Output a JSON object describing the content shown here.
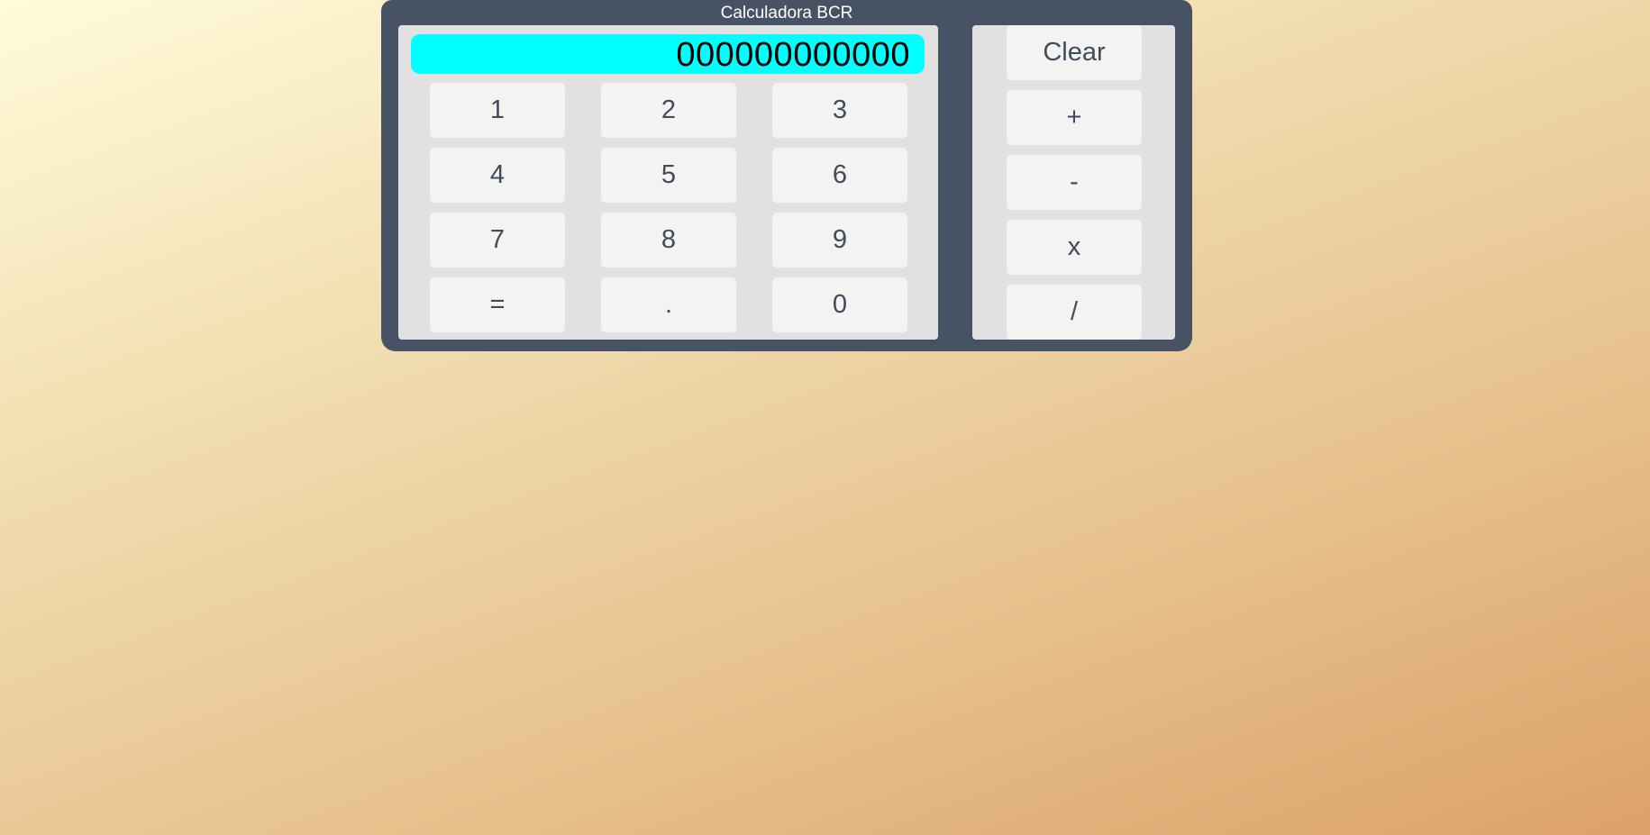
{
  "app": {
    "title": "Calculadora BCR"
  },
  "display": {
    "value": "000000000000"
  },
  "keypad": {
    "keys": [
      "1",
      "2",
      "3",
      "4",
      "5",
      "6",
      "7",
      "8",
      "9",
      "=",
      ".",
      "0"
    ]
  },
  "operators": {
    "clear": "Clear",
    "add": "+",
    "subtract": "-",
    "multiply": "x",
    "divide": "/"
  },
  "colors": {
    "frame": "#475365",
    "panel": "#e1e1e1",
    "display_bg": "#00ffff",
    "key_bg": "#f3f3f2",
    "key_text": "#414b5b"
  }
}
